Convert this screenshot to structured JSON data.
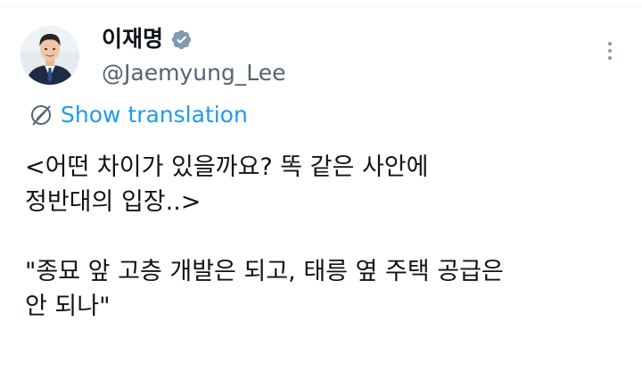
{
  "tweet": {
    "author": {
      "display_name": "이재명",
      "handle": "@Jaemyung_Lee",
      "verified": true,
      "verified_icon": "verified-badge-icon"
    },
    "translate_label": "Show translation",
    "translate_icon": "globe-strike-icon",
    "more_icon": "more-options-icon",
    "text": "<어떤 차이가 있을까요? 똑 같은 사안에\n정반대의 입장..>\n\n\"종묘 앞 고층 개발은 되고, 태릉 옆 주택 공급은\n안 되나\""
  },
  "colors": {
    "text": "#0f1419",
    "secondary_text": "#536471",
    "link": "#1d9bf0",
    "verified_badge": "#829aab"
  }
}
